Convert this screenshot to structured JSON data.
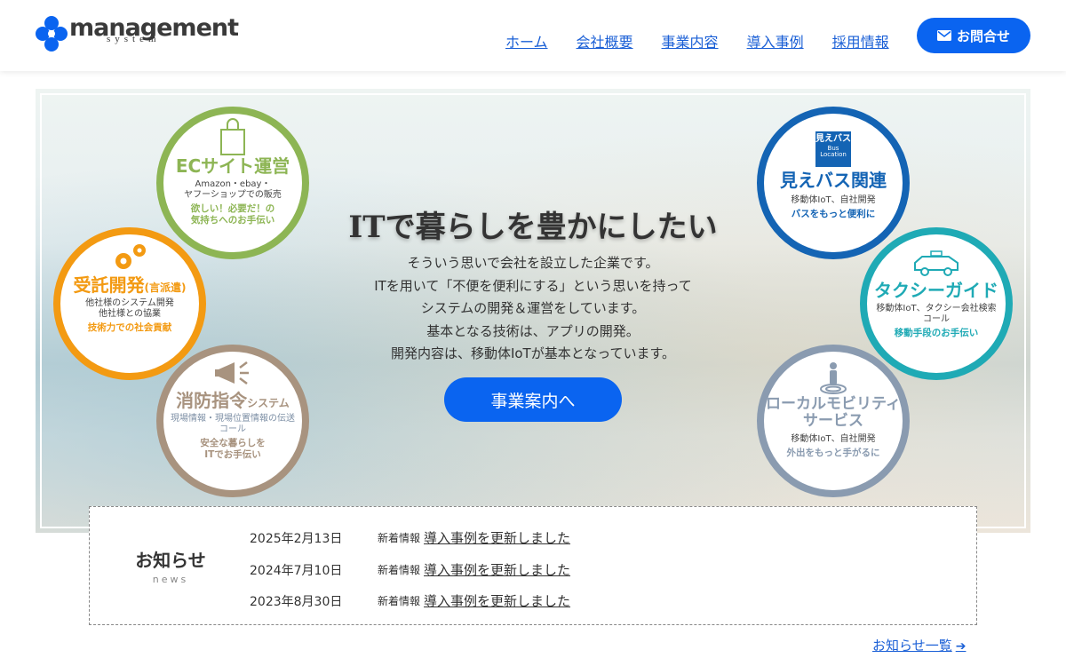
{
  "logo": {
    "main": "management",
    "sub": "system"
  },
  "nav": [
    "ホーム",
    "会社概要",
    "事業内容",
    "導入事例",
    "採用情報"
  ],
  "contact": {
    "label": "お問合せ",
    "icon": "envelope-icon"
  },
  "hero": {
    "title": "ITで暮らしを豊かにしたい",
    "lines": [
      "そういう思いで会社を設立した企業です。",
      "ITを用いて「不便を便利にする」という思いを持って",
      "システムの開発＆運営をしています。",
      "基本となる技術は、アプリの開発。",
      "開発内容は、移動体IoTが基本となっています。"
    ],
    "button": "事業案内へ"
  },
  "services": {
    "ec": {
      "title": "ECサイト運営",
      "sub1": "Amazon・ebay・",
      "sub2": "ヤフーショップでの販売",
      "em1": "欲しい！必要だ！の",
      "em2": "気持ちへのお手伝い",
      "color": "#8db554",
      "icon": "shopping-bag-icon"
    },
    "contract": {
      "title": "受託開発",
      "tag": "(言派遣)",
      "sub1": "他社様のシステム開発",
      "sub2": "他社様との協業",
      "em1": "技術力での社会貢献",
      "color": "#f39a12",
      "icon": "gears-icon"
    },
    "fire": {
      "title": "消防指令",
      "tag": "システム",
      "sub1": "現場情報・現場位置情報の伝送",
      "sub2": "コール",
      "em1": "安全な暮らしを",
      "em2": "ITでお手伝い",
      "color": "#a8937f",
      "icon": "megaphone-icon"
    },
    "bus": {
      "title": "見えバス関連",
      "badge1": "見えバス",
      "badge2": "Bus",
      "badge3": "Location",
      "sub1": "移動体IoT、自社開発",
      "em1": "バスをもっと便利に",
      "color": "#1464b4",
      "icon": "bus-location-icon"
    },
    "taxi": {
      "title": "タクシーガイド",
      "sub1": "移動体IoT、タクシー会社検索",
      "sub2": "コール",
      "em1": "移動手段のお手伝い",
      "color": "#1faab5",
      "icon": "taxi-icon"
    },
    "mobility": {
      "title1": "ローカルモビリティ",
      "title2": "サービス",
      "sub1": "移動体IoT、自社開発",
      "em1": "外出をもっと手がるに",
      "color": "#8a9bb0",
      "icon": "person-location-icon"
    }
  },
  "news": {
    "heading": "お知らせ",
    "sub": "news",
    "items": [
      {
        "date": "2025年2月13日",
        "cat": "新着情報",
        "text": "導入事例を更新しました"
      },
      {
        "date": "2024年7月10日",
        "cat": "新着情報",
        "text": "導入事例を更新しました"
      },
      {
        "date": "2023年8月30日",
        "cat": "新着情報",
        "text": "導入事例を更新しました"
      }
    ],
    "more": "お知らせ一覧"
  }
}
